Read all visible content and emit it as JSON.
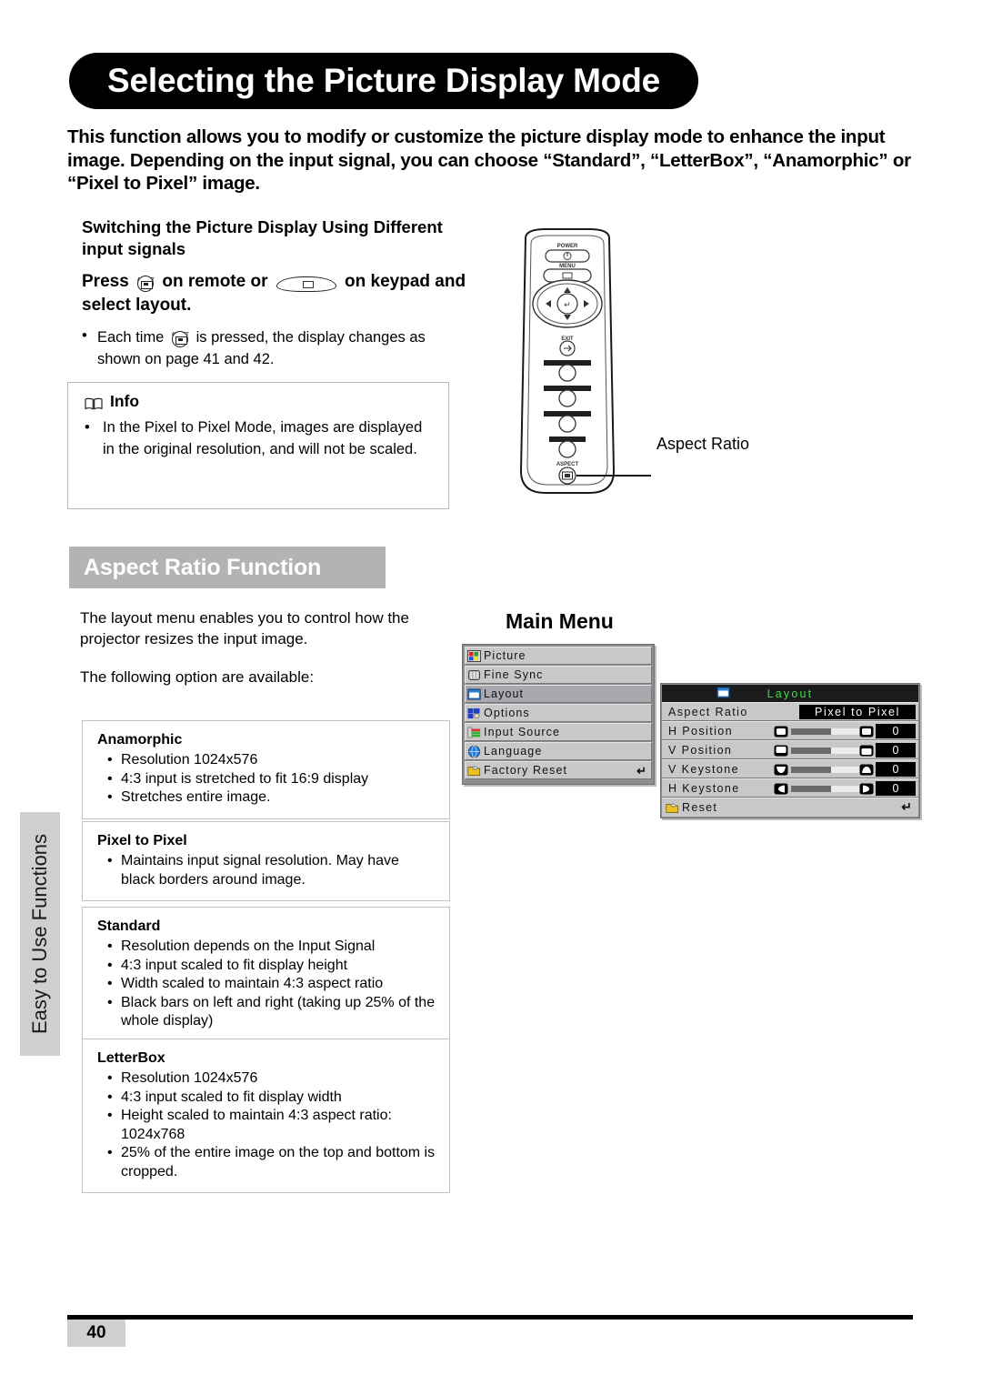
{
  "page": {
    "title": "Selecting the Picture Display Mode",
    "intro": "This function allows you to modify or customize the picture display mode to enhance the input image. Depending on the input signal, you can choose “Standard”, “LetterBox”, “Anamorphic” or “Pixel to Pixel” image.",
    "number": "40",
    "side_tab": "Easy to Use Functions"
  },
  "switching": {
    "heading": "Switching the Picture Display Using Different input signals",
    "press_prefix": "Press",
    "press_mid": "on remote or",
    "press_suffix": "on keypad and select layout.",
    "each_time_prefix": "Each time",
    "each_time_suffix": "is pressed, the display changes as shown on page 41 and 42.",
    "aspect_icon_label": "ASPECT",
    "menu_icon_label": "MENU"
  },
  "info": {
    "heading": "Info",
    "bullet": "In the Pixel to Pixel Mode, images are displayed in the original resolution, and will not be scaled."
  },
  "remote": {
    "callout": "Aspect Ratio",
    "labels": {
      "power": "POWER",
      "menu": "MENU",
      "exit": "EXIT",
      "aspect": "ASPECT"
    }
  },
  "aspect_section": {
    "heading": "Aspect Ratio Function",
    "lead1": "The layout menu enables you to control how the projector resizes the input image.",
    "lead2": "The following option are available:"
  },
  "options": [
    {
      "name": "Anamorphic",
      "bullets": [
        "Resolution 1024x576",
        "4:3 input is stretched to fit 16:9 display",
        "Stretches entire image."
      ]
    },
    {
      "name": "Pixel to Pixel",
      "bullets": [
        "Maintains input signal resolution. May have black borders around image."
      ]
    },
    {
      "name": "Standard",
      "bullets": [
        "Resolution depends on the Input Signal",
        "4:3 input scaled to fit display height",
        "Width scaled to maintain 4:3 aspect ratio",
        "Black bars on left and right (taking up 25% of the whole display)"
      ]
    },
    {
      "name": "LetterBox",
      "bullets": [
        "Resolution 1024x576",
        "4:3 input scaled to fit display width",
        "Height scaled to maintain 4:3 aspect ratio: 1024x768",
        "25% of the entire image on the top and bottom is cropped."
      ]
    }
  ],
  "main_menu": {
    "title": "Main Menu",
    "items": [
      {
        "label": "Picture",
        "icon": "picture-icon",
        "selected": false,
        "enter": ""
      },
      {
        "label": "Fine Sync",
        "icon": "fine-sync-icon",
        "selected": false,
        "enter": ""
      },
      {
        "label": "Layout",
        "icon": "layout-icon",
        "selected": true,
        "enter": ""
      },
      {
        "label": "Options",
        "icon": "options-icon",
        "selected": false,
        "enter": ""
      },
      {
        "label": "Input Source",
        "icon": "input-source-icon",
        "selected": false,
        "enter": ""
      },
      {
        "label": "Language",
        "icon": "language-icon",
        "selected": false,
        "enter": ""
      },
      {
        "label": "Factory Reset",
        "icon": "factory-reset-icon",
        "selected": false,
        "enter": "↵"
      }
    ]
  },
  "layout_menu": {
    "title": "Layout",
    "aspect_ratio": {
      "label": "Aspect Ratio",
      "value": "Pixel to Pixel"
    },
    "sliders": [
      {
        "label": "H Position",
        "value": "0"
      },
      {
        "label": "V Position",
        "value": "0"
      },
      {
        "label": "V Keystone",
        "value": "0"
      },
      {
        "label": "H Keystone",
        "value": "0"
      }
    ],
    "reset": {
      "label": "Reset",
      "enter": "↵"
    }
  },
  "colors": {
    "title_bar": "#000000",
    "section_heading_bg": "#b3b3b3",
    "osd_row": "#c8c8c8",
    "osd_selected": "#a8a8ae",
    "osd_header": "#1b1b1b",
    "osd_title_text": "#3ddc45",
    "side_tab_bg": "#cfcfcf"
  }
}
